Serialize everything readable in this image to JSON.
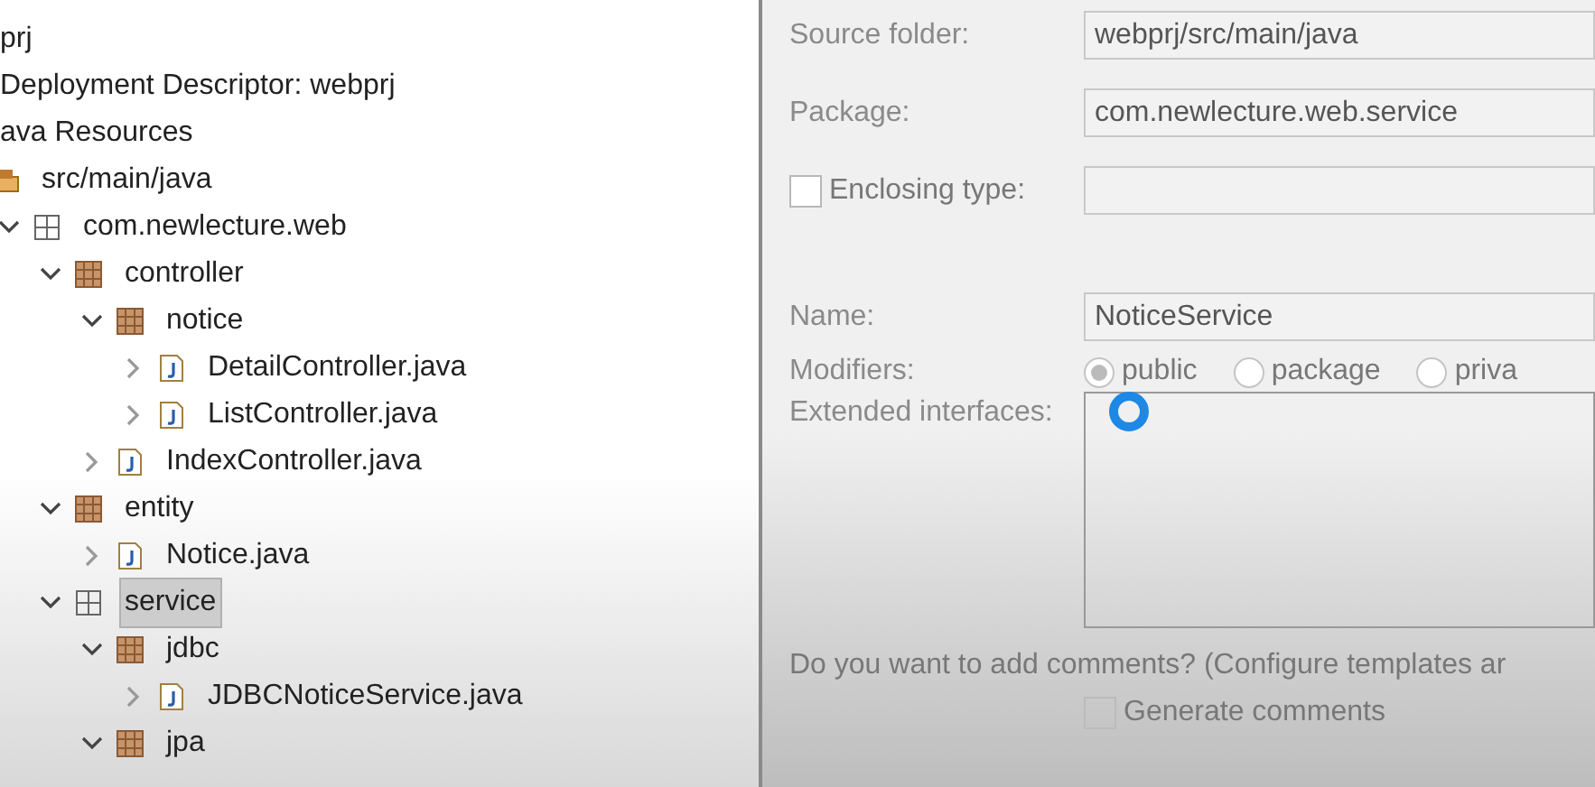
{
  "tree": [
    {
      "label": "prj",
      "selected": false
    },
    {
      "label": "Deployment Descriptor: webprj",
      "selected": false
    },
    {
      "label": "ava Resources",
      "selected": false,
      "children": [
        {
          "label": "src/main/java",
          "kind": "source-folder",
          "selected": false,
          "children": [
            {
              "label": "com.newlecture.web",
              "kind": "empty-package",
              "expanded": true,
              "selected": false,
              "children": [
                {
                  "label": "controller",
                  "kind": "package",
                  "expanded": true,
                  "selected": false,
                  "children": [
                    {
                      "label": "notice",
                      "kind": "package",
                      "expanded": true,
                      "selected": false,
                      "children": [
                        {
                          "label": "DetailController.java",
                          "kind": "java-file",
                          "expanded": false,
                          "selected": false
                        },
                        {
                          "label": "ListController.java",
                          "kind": "java-file",
                          "expanded": false,
                          "selected": false
                        }
                      ]
                    },
                    {
                      "label": "IndexController.java",
                      "kind": "java-file",
                      "expanded": false,
                      "selected": false
                    }
                  ]
                },
                {
                  "label": "entity",
                  "kind": "package",
                  "expanded": true,
                  "selected": false,
                  "children": [
                    {
                      "label": "Notice.java",
                      "kind": "java-file",
                      "expanded": false,
                      "selected": false
                    }
                  ]
                },
                {
                  "label": "service",
                  "kind": "empty-package",
                  "expanded": true,
                  "selected": true,
                  "children": [
                    {
                      "label": "jdbc",
                      "kind": "package",
                      "expanded": true,
                      "selected": false,
                      "children": [
                        {
                          "label": "JDBCNoticeService.java",
                          "kind": "java-file",
                          "expanded": false,
                          "selected": false
                        }
                      ]
                    },
                    {
                      "label": "jpa",
                      "kind": "package",
                      "expanded": true,
                      "selected": false
                    }
                  ]
                }
              ]
            }
          ]
        }
      ]
    }
  ],
  "form": {
    "source_folder": {
      "label": "Source folder:",
      "value": "webprj/src/main/java"
    },
    "package": {
      "label": "Package:",
      "value": "com.newlecture.web.service"
    },
    "enclosing_type": {
      "label": "Enclosing type:",
      "checked": false
    },
    "name": {
      "label": "Name:",
      "value": "NoticeService"
    },
    "modifiers": {
      "label": "Modifiers:",
      "options": [
        {
          "label": "public",
          "selected": true
        },
        {
          "label": "package",
          "selected": false
        },
        {
          "label": "priva",
          "selected": false
        }
      ]
    },
    "extended_interfaces": {
      "label": "Extended interfaces:"
    },
    "comments_prompt": "Do you want to add comments? (Configure templates ar",
    "generate_comments": {
      "label": "Generate comments",
      "checked": false
    }
  }
}
